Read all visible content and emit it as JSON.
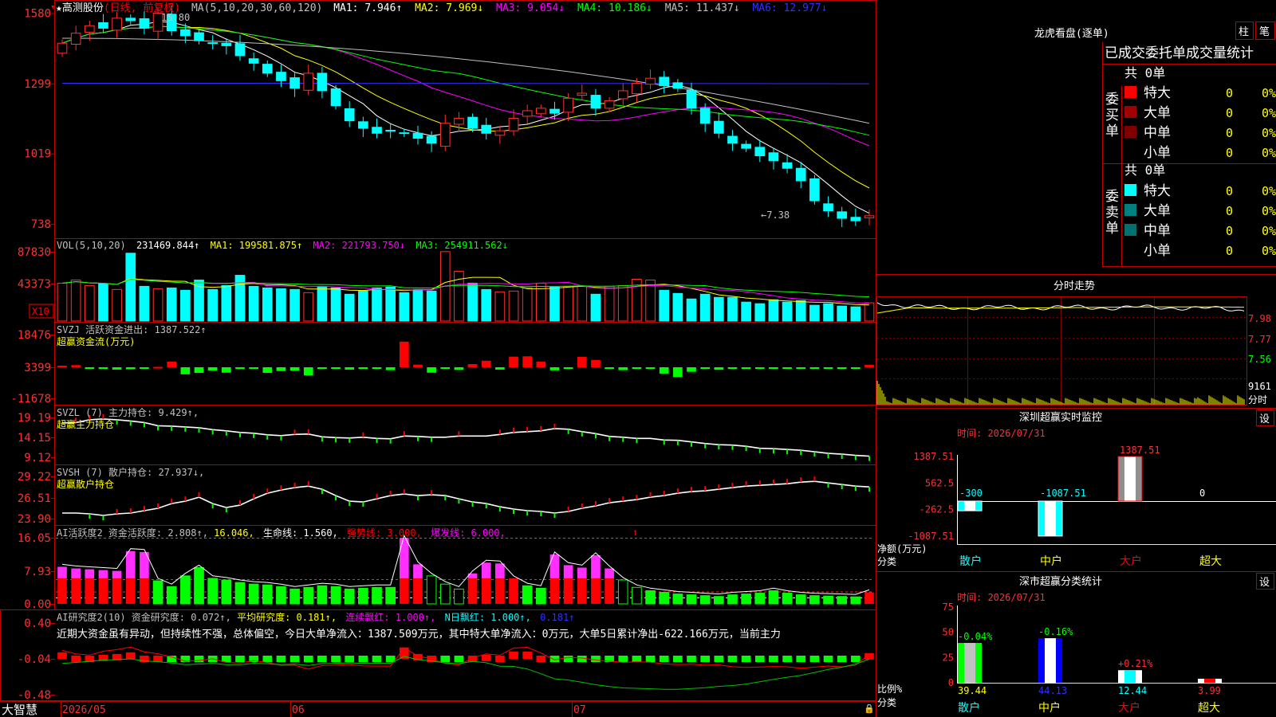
{
  "app": {
    "brand": "大智慧"
  },
  "main": {
    "header": {
      "star": "★",
      "stock_name": "高测股份",
      "period": "(日线, 前复权)",
      "ma_prefix": "MA(5,10,20,30,60,120)",
      "items": [
        {
          "text": "MA1: 7.946↑",
          "color": "#ffffff"
        },
        {
          "text": "MA2: 7.969↓",
          "color": "#ffff00"
        },
        {
          "text": "MA3: 9.054↓",
          "color": "#ff00ff"
        },
        {
          "text": "MA4: 10.186↓",
          "color": "#00ff00"
        },
        {
          "text": "MA5: 11.437↓",
          "color": "#c0c0c0"
        },
        {
          "text": "MA6: 12.977↓",
          "color": "#3030ff"
        }
      ]
    },
    "y_ticks": [
      "1580",
      "1299",
      "1019",
      "738"
    ],
    "y_tick_values": [
      15.8,
      12.99,
      10.19,
      7.38
    ],
    "high_label": "15.80",
    "low_label": "←7.38",
    "ylim": [
      6.9,
      16.2
    ]
  },
  "vol": {
    "header": [
      {
        "text": "VOL(5,10,20)",
        "color": "#c0c0c0"
      },
      {
        "text": "231469.844↑",
        "color": "#ffffff"
      },
      {
        "text": "MA1: 199581.875↑",
        "color": "#ffff00"
      },
      {
        "text": "MA2: 221793.750↓",
        "color": "#ff00ff"
      },
      {
        "text": "MA3: 254911.562↓",
        "color": "#00ff00"
      }
    ],
    "y_ticks": [
      "87830",
      "43373"
    ],
    "unit_badge": "X10"
  },
  "svzj": {
    "title": "SVZJ  活跃资金进出: 1387.522↑",
    "subtitle": "超赢资金流(万元)",
    "y_ticks": [
      "18476",
      "3399",
      "-11678"
    ]
  },
  "svzl": {
    "title": "SVZL (7) 主力持仓: 9.429↑,",
    "subtitle": "超赢主力持仓",
    "y_ticks": [
      "19.19",
      "14.15",
      "9.12"
    ]
  },
  "svsh": {
    "title": "SVSH (7) 散户持仓: 27.937↓,",
    "subtitle": "超赢散户持仓",
    "y_ticks": [
      "29.22",
      "26.51",
      "23.90"
    ]
  },
  "ai1": {
    "header": [
      {
        "text": "AI活跃度2 资金活跃度: 2.808↑,",
        "color": "#c0c0c0"
      },
      {
        "text": "16.046,",
        "color": "#ffff00"
      },
      {
        "text": "生命线: 1.560,",
        "color": "#ffffff"
      },
      {
        "text": "强势线: 3.000,",
        "color": "#ff0000"
      },
      {
        "text": "爆发线: 6.000,",
        "color": "#ff00ff"
      }
    ],
    "y_ticks": [
      "16.05",
      "7.93",
      "0.00"
    ]
  },
  "ai2": {
    "header": [
      {
        "text": "AI研究度2(10) 资金研究度: 0.072↑,",
        "color": "#c0c0c0"
      },
      {
        "text": "平均研究度: 0.181↑,",
        "color": "#ffff00"
      },
      {
        "text": "连续飘红: 1.000↑,",
        "color": "#ff00ff"
      },
      {
        "text": "N日飘红: 1.000↑,",
        "color": "#00ffff"
      },
      {
        "text": "0.181↑",
        "color": "#3030ff"
      }
    ],
    "note": "近期大资金虽有异动，但持续性不强，总体偏空，今日大单净流入：1387.509万元，其中特大单净流入：0万元，大单5日累计净出-622.166万元，当前主力",
    "y_ticks": [
      "0.40",
      "-0.04",
      "-0.48"
    ]
  },
  "x_axis": [
    "2026/05",
    "06",
    "07"
  ],
  "right": {
    "lhb": {
      "title": "龙虎看盘(逐单)",
      "btn_zhu": "柱",
      "btn_bi": "笔",
      "subtitle": "已成交委托单成交量统计",
      "buy": {
        "count": "共 0单",
        "side": "委买单",
        "rows": [
          {
            "name": "特大",
            "v": "0",
            "p": "0%",
            "color": "#ff0000"
          },
          {
            "name": "大单",
            "v": "0",
            "p": "0%",
            "color": "#a00000"
          },
          {
            "name": "中单",
            "v": "0",
            "p": "0%",
            "color": "#800000"
          },
          {
            "name": "小单",
            "v": "0",
            "p": "0%",
            "color": ""
          }
        ]
      },
      "sell": {
        "count": "共 0单",
        "side": "委卖单",
        "rows": [
          {
            "name": "特大",
            "v": "0",
            "p": "0%",
            "color": "#00ffff"
          },
          {
            "name": "大单",
            "v": "0",
            "p": "0%",
            "color": "#008080"
          },
          {
            "name": "中单",
            "v": "0",
            "p": "0%",
            "color": "#007070"
          },
          {
            "name": "小单",
            "v": "0",
            "p": "0%",
            "color": ""
          }
        ]
      }
    },
    "fenshi": {
      "title": "分时走势",
      "y_ticks": [
        "7.98",
        "7.77",
        "7.56"
      ],
      "vol_label": "9161",
      "unit": "分时"
    },
    "monitor": {
      "title": "深圳超赢实时监控",
      "btn": "设",
      "time": "时间: 2026/07/31",
      "y_ticks": [
        "1387.51",
        "562.5",
        "-262.5",
        "-1087.51"
      ],
      "left_label1": "净额(万元)",
      "left_label2": "分类",
      "categories": [
        "散户",
        "中户",
        "大户",
        "超大"
      ],
      "values": [
        -300,
        -1087.51,
        1387.51,
        0
      ],
      "value_labels": [
        "-300",
        "-1087.51",
        "1387.51",
        "0"
      ]
    },
    "classify": {
      "title": "深市超赢分类统计",
      "btn": "设",
      "time": "时间: 2026/07/31",
      "y_ticks": [
        "75",
        "50",
        "25",
        "0"
      ],
      "left_label1": "比例%",
      "left_label2": "分类",
      "categories": [
        "散户",
        "中户",
        "大户",
        "超大"
      ],
      "values": [
        39.44,
        44.13,
        12.44,
        3.99
      ],
      "value_labels": [
        "39.44",
        "44.13",
        "12.44",
        "3.99"
      ],
      "change_labels": [
        "-0.04%",
        "-0.16%",
        "+0.21%",
        ""
      ]
    }
  },
  "chart_data": {
    "type": "candlestick",
    "count": 60,
    "close": [
      14.6,
      15.0,
      15.3,
      15.2,
      15.6,
      15.5,
      15.2,
      15.8,
      15.1,
      14.9,
      14.7,
      14.6,
      14.5,
      14.1,
      13.8,
      13.4,
      13.1,
      12.8,
      13.4,
      12.7,
      12.1,
      11.5,
      11.2,
      11.0,
      11.1,
      11.0,
      10.8,
      10.6,
      11.4,
      11.6,
      11.2,
      11.0,
      11.1,
      11.6,
      11.9,
      12.0,
      11.8,
      12.4,
      12.6,
      12.0,
      12.3,
      12.7,
      13.0,
      13.2,
      12.9,
      12.8,
      12.0,
      11.4,
      11.0,
      10.6,
      10.4,
      10.1,
      9.9,
      9.6,
      9.1,
      8.3,
      7.9,
      7.6,
      7.5,
      7.7
    ],
    "volume": [
      48000,
      52000,
      45000,
      47000,
      40000,
      86000,
      44000,
      41000,
      42000,
      39000,
      52000,
      40000,
      45000,
      58000,
      44000,
      42000,
      41000,
      40000,
      36000,
      44000,
      42000,
      34000,
      38000,
      42000,
      43000,
      36000,
      40000,
      38000,
      88000,
      63000,
      48000,
      40000,
      37000,
      38000,
      42000,
      48000,
      43000,
      44000,
      44000,
      34000,
      44000,
      45000,
      53000,
      52000,
      39000,
      35000,
      28000,
      34000,
      30000,
      30000,
      24000,
      22000,
      27000,
      24000,
      26000,
      20000,
      22000,
      19000,
      18000,
      23147
    ],
    "svzj": [
      900,
      1200,
      -900,
      -700,
      -1300,
      -1100,
      -400,
      200,
      3200,
      -3900,
      -3100,
      -1800,
      -3000,
      -1000,
      -800,
      -3100,
      -2100,
      -1900,
      -4500,
      -700,
      -900,
      -1300,
      -700,
      -300,
      -1600,
      14500,
      1500,
      -3000,
      -700,
      -1500,
      1800,
      3700,
      -1300,
      6000,
      6200,
      3200,
      -1700,
      -900,
      5900,
      4100,
      -900,
      -1600,
      -700,
      -900,
      -3500,
      -5400,
      -2500,
      -900,
      -1400,
      -900,
      -600,
      -700,
      -700,
      -500,
      -600,
      -500,
      -400,
      -500,
      -400,
      1387.5
    ],
    "svzl": [
      17.8,
      17.9,
      18.6,
      18.8,
      18.6,
      18.3,
      17.9,
      17.1,
      17.0,
      16.8,
      16.6,
      16.1,
      15.8,
      15.4,
      15.2,
      14.8,
      14.6,
      14.9,
      15.0,
      14.3,
      14.1,
      14.0,
      14.2,
      13.9,
      13.8,
      14.5,
      14.4,
      14.2,
      14.2,
      14.5,
      14.5,
      14.5,
      14.9,
      15.4,
      15.6,
      15.8,
      16.4,
      16.2,
      15.6,
      15.1,
      14.4,
      14.2,
      13.9,
      13.9,
      13.5,
      13.4,
      13.0,
      12.6,
      12.3,
      12.2,
      11.9,
      11.4,
      11.3,
      11.1,
      10.9,
      10.5,
      10.1,
      9.9,
      9.6,
      9.4
    ],
    "svsh": [
      24.6,
      24.6,
      24.5,
      24.3,
      24.5,
      24.6,
      24.9,
      25.2,
      25.8,
      26.1,
      26.6,
      25.8,
      25.3,
      25.6,
      26.4,
      27.1,
      27.5,
      27.8,
      28.0,
      27.6,
      26.8,
      26.1,
      26.0,
      26.4,
      26.8,
      27.0,
      26.8,
      26.9,
      26.8,
      26.4,
      26.0,
      25.8,
      25.4,
      25.1,
      24.9,
      24.8,
      24.6,
      24.8,
      25.2,
      25.5,
      25.9,
      26.1,
      26.3,
      26.6,
      26.8,
      27.1,
      27.3,
      27.4,
      27.6,
      27.8,
      28.0,
      28.1,
      28.2,
      28.3,
      28.5,
      28.6,
      28.4,
      28.2,
      28.0,
      27.9
    ],
    "ai1": [
      9.0,
      8.6,
      8.4,
      8.2,
      8.0,
      12.8,
      12.6,
      5.6,
      4.2,
      6.8,
      8.8,
      6.2,
      5.8,
      5.2,
      4.8,
      4.6,
      4.2,
      3.6,
      4.0,
      4.4,
      4.2,
      3.6,
      3.8,
      4.0,
      4.0,
      16.0,
      9.6,
      6.8,
      4.8,
      3.6,
      7.4,
      10.0,
      9.8,
      6.2,
      4.4,
      3.8,
      12.0,
      9.4,
      8.8,
      11.8,
      8.6,
      5.8,
      4.0,
      3.2,
      2.8,
      2.4,
      2.2,
      2.0,
      1.8,
      2.2,
      2.4,
      2.6,
      3.2,
      2.6,
      2.2,
      2.0,
      1.9,
      1.8,
      1.7,
      2.8
    ],
    "ai2": [
      0.08,
      0.04,
      0.02,
      0.05,
      0.06,
      0.08,
      0.03,
      0.01,
      -0.02,
      -0.06,
      -0.05,
      -0.03,
      -0.06,
      -0.06,
      -0.03,
      -0.04,
      -0.06,
      -0.05,
      -0.08,
      -0.04,
      -0.03,
      -0.02,
      -0.03,
      -0.03,
      -0.03,
      0.14,
      0.06,
      0.03,
      -0.02,
      -0.04,
      0.02,
      0.05,
      0.03,
      0.09,
      0.09,
      0.03,
      -0.04,
      -0.02,
      -0.03,
      -0.05,
      -0.06,
      -0.07,
      -0.06,
      -0.06,
      -0.07,
      -0.07,
      -0.06,
      -0.06,
      -0.05,
      -0.06,
      -0.06,
      -0.05,
      -0.04,
      -0.04,
      -0.05,
      -0.04,
      -0.03,
      -0.04,
      -0.03,
      0.07
    ]
  }
}
